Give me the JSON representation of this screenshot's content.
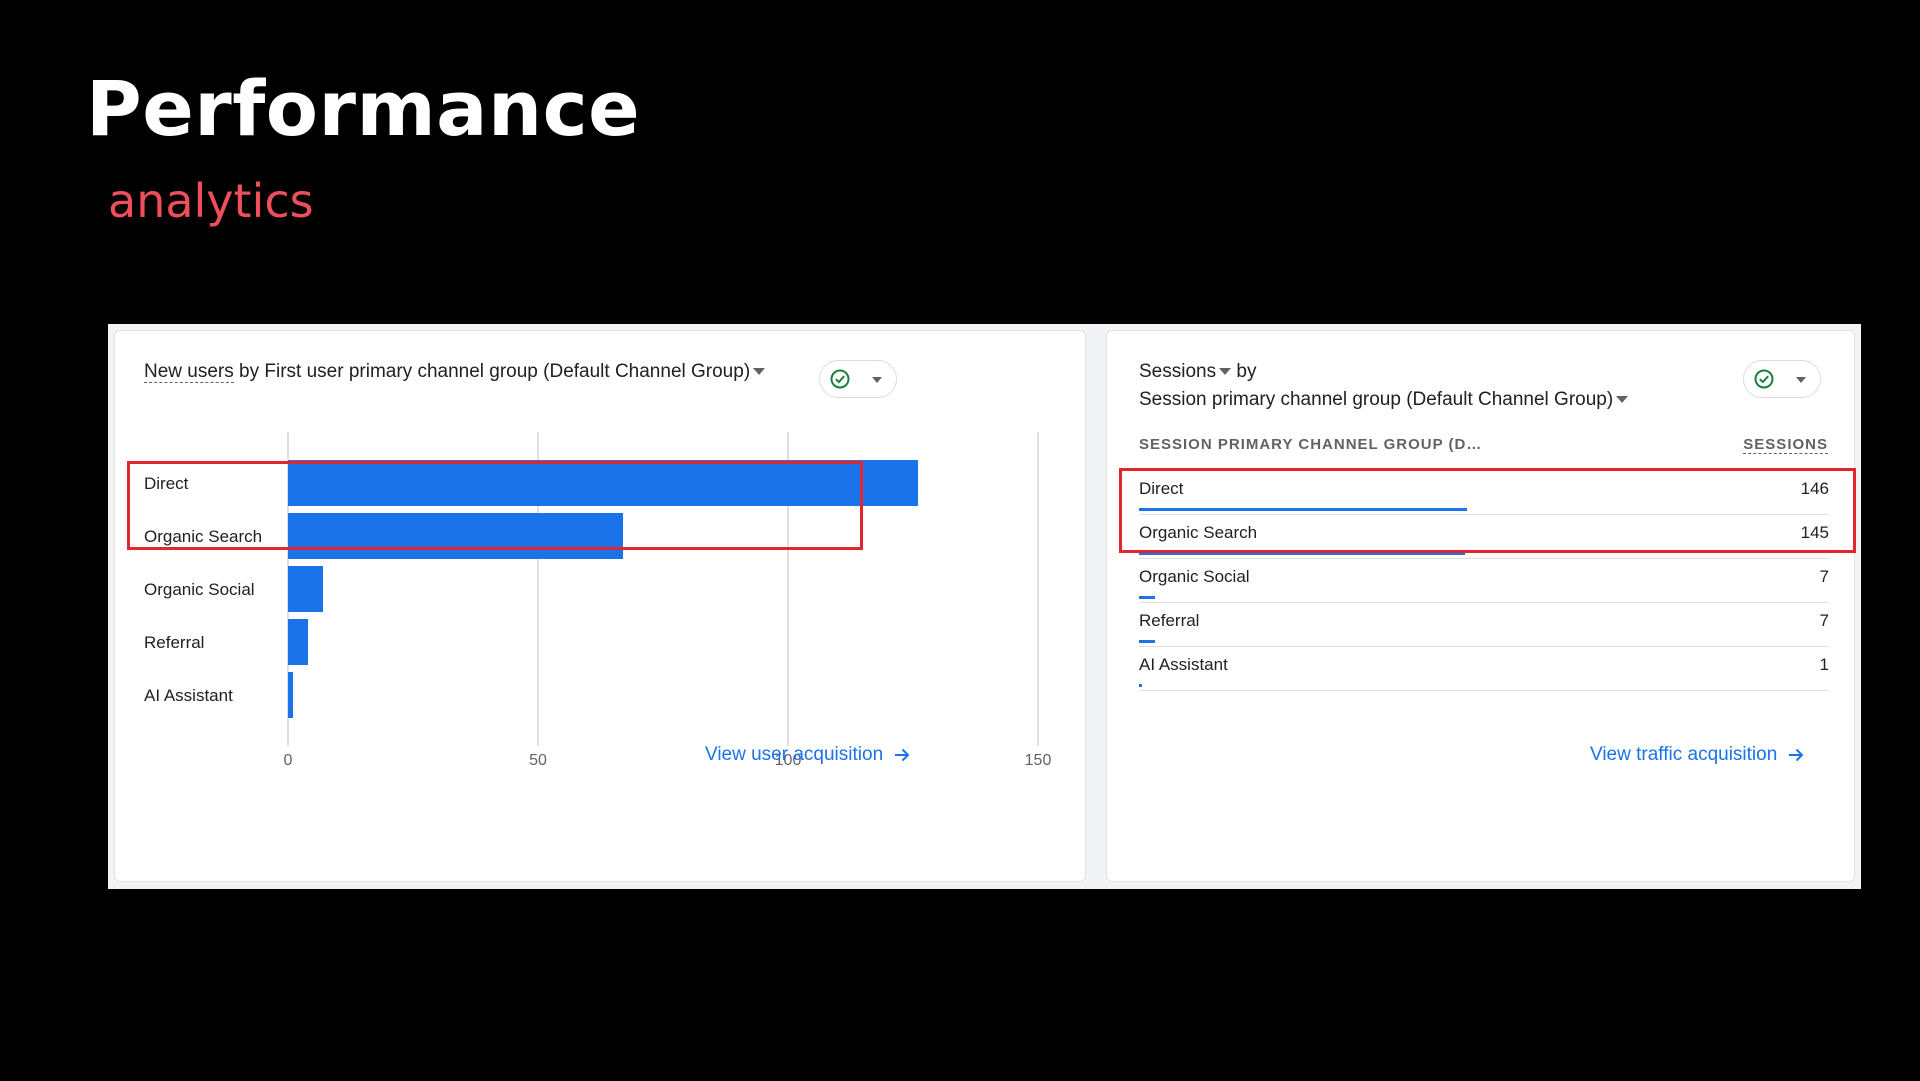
{
  "slide": {
    "title": "Performance",
    "subtitle": "analytics"
  },
  "left_card": {
    "title_metric": "New users",
    "title_rest": " by First user primary channel group (Default Channel Group)",
    "link_label": "View user acquisition",
    "chart_data": {
      "type": "bar",
      "orientation": "horizontal",
      "categories": [
        "Direct",
        "Organic Search",
        "Organic Social",
        "Referral",
        "AI Assistant"
      ],
      "values": [
        126,
        67,
        7,
        4,
        1
      ],
      "xlim": [
        0,
        150
      ],
      "xticks": [
        0,
        50,
        100,
        150
      ],
      "grid": true,
      "bar_color": "#1a73e8"
    }
  },
  "right_card": {
    "title_metric": "Sessions",
    "title_by": " by",
    "title_line2": "Session primary channel group (Default Channel Group)",
    "col_label": "SESSION PRIMARY CHANNEL GROUP (D…",
    "col_value": "SESSIONS",
    "link_label": "View traffic acquisition",
    "rows": [
      {
        "label": "Direct",
        "value": "146"
      },
      {
        "label": "Organic Search",
        "value": "145"
      },
      {
        "label": "Organic Social",
        "value": "7"
      },
      {
        "label": "Referral",
        "value": "7"
      },
      {
        "label": "AI Assistant",
        "value": "1"
      }
    ]
  },
  "colors": {
    "accent": "#1a73e8",
    "highlight": "#e0262e",
    "subtitle": "#ee4f5c",
    "check": "#188038"
  },
  "icons": {
    "status": "check-circle-icon",
    "dropdown": "chevron-down-icon",
    "link": "arrow-right-icon"
  }
}
